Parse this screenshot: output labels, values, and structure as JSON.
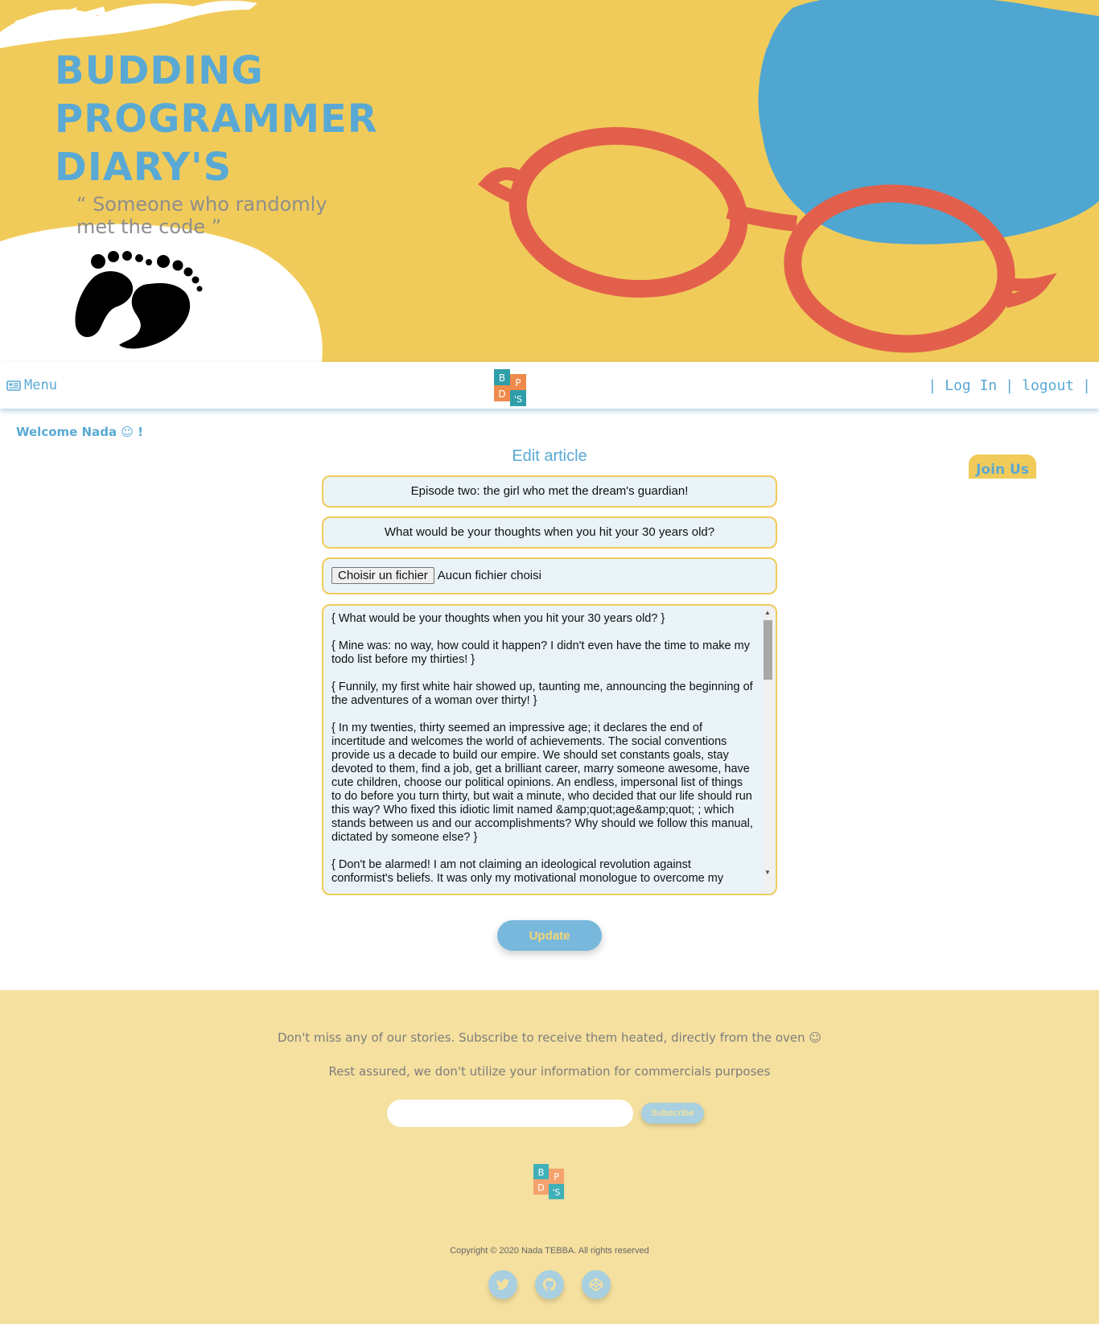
{
  "hero": {
    "title_lines": [
      "BUDDING",
      "PROGRAMMER",
      "DIARY'S"
    ],
    "tagline": "“ Someone who randomly met the code ”",
    "colors": {
      "background": "#f1cb5a",
      "accent_blue": "#4fa6d1",
      "glasses_red": "#e2604b",
      "title_blue": "#5aa9d4"
    }
  },
  "navbar": {
    "menu_label": "Menu",
    "menu_icon": "newspaper-icon",
    "logo_letters": [
      "B",
      "P",
      "D",
      "'S"
    ],
    "login_label": "Log In",
    "logout_label": "logout"
  },
  "welcome": "Welcome Nada ☺ !",
  "join_label": "Join Us",
  "form": {
    "heading": "Edit article",
    "title_value": "Episode two: the girl who met the dream's guardian!",
    "subtitle_value": "What would be your thoughts when you hit your 30 years old?",
    "file_button": "Choisir un fichier",
    "file_status": "Aucun fichier choisi",
    "content_value": "{ What would be your thoughts when you hit your 30 years old? }\n\n{ Mine was: no way, how could it happen? I didn't even have the time to make my todo list before my thirties! }\n\n{ Funnily, my first white hair showed up, taunting me, announcing the beginning of the adventures of a woman over thirty! }\n\n{ In my twenties, thirty seemed an impressive age; it declares the end of incertitude and welcomes the world of achievements. The social conventions provide us a decade to build our empire. We should set constants goals, stay devoted to them, find a job, get a brilliant career, marry someone awesome, have cute children, choose our political opinions. An endless, impersonal list of things to do before you turn thirty, but wait a minute, who decided that our life should run this way? Who fixed this idiotic limit named &amp;quot;age&amp;quot; ; which stands between us and our accomplishments? Why should we follow this manual, dictated by someone else? }\n\n{ Don't be alarmed! I am not claiming an ideological revolution against conformist's beliefs. It was only my motivational monologue to overcome my",
    "update_label": "Update"
  },
  "footer": {
    "line1": "Don't miss any of our stories. Subscribe to receive them heated, directly from the oven ☺",
    "line2": "Rest assured, we don't utilize your information for commercials purposes",
    "subscribe_label": "Subscribe",
    "copyright": "Copyright © 2020 Nada TEBBA. All rights reserved",
    "social_icons": [
      "twitter-icon",
      "github-icon",
      "codepen-icon"
    ]
  }
}
